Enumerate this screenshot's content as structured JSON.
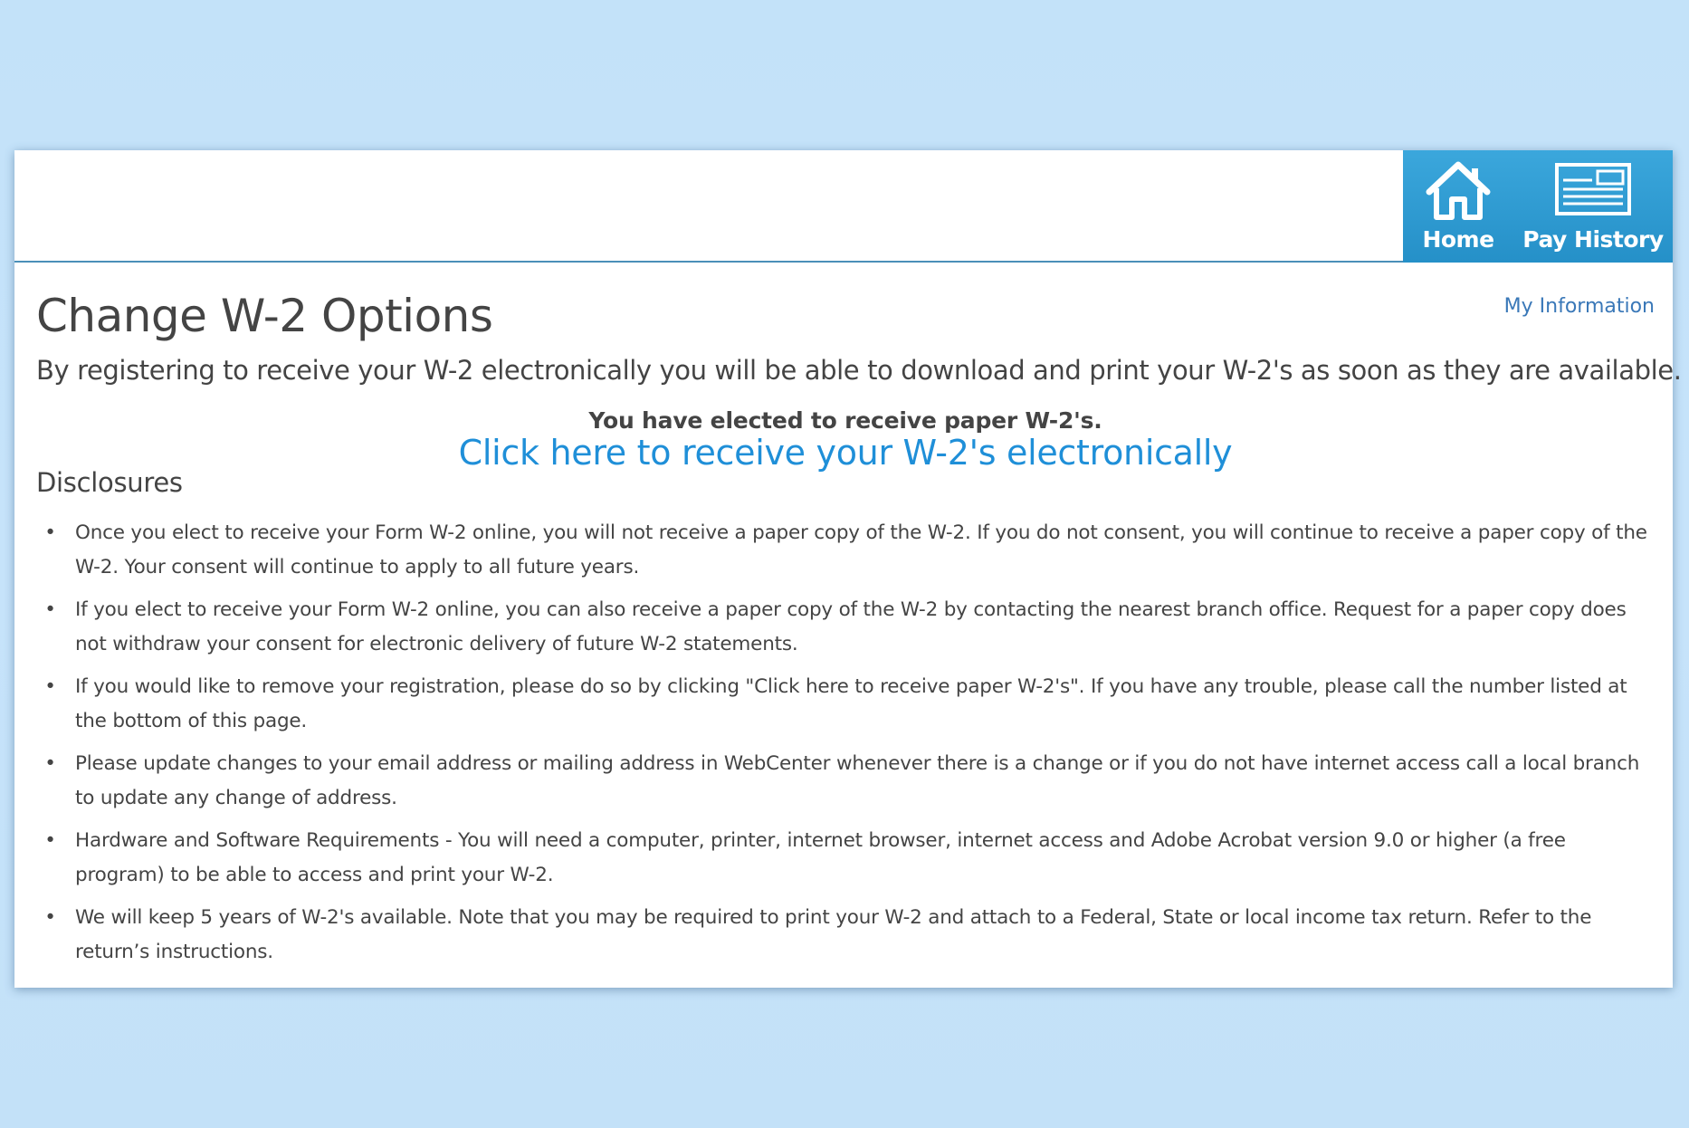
{
  "nav": {
    "home_label": "Home",
    "pay_history_label": "Pay History"
  },
  "page": {
    "title": "Change W-2 Options",
    "my_information_link": "My Information",
    "intro": "By registering to receive your W-2 electronically you will be able to download and print your W-2's as soon as they are available.",
    "elected_status": "You have elected to receive paper W-2's.",
    "electronic_link": "Click here to receive your W-2's electronically"
  },
  "disclosures": {
    "heading": "Disclosures",
    "items": [
      "Once you elect to receive your Form W-2 online, you will not receive a paper copy of the W-2. If you do not consent, you will continue to receive a paper copy of the W-2. Your consent will continue to apply to all future years.",
      "If you elect to receive your Form W-2 online, you can also receive a paper copy of the W-2 by contacting the nearest branch office. Request for a paper copy does not withdraw your consent for electronic delivery of future W-2 statements.",
      "If you would like to remove your registration, please do so by clicking \"Click here to receive paper W-2's\". If you have any trouble, please call the number listed at the bottom of this page.",
      "Please update changes to your email address or mailing address in WebCenter whenever there is a change or if you do not have internet access call a local branch to update any change of address.",
      "Hardware and Software Requirements - You will need a computer, printer, internet browser, internet access and Adobe Acrobat version 9.0 or higher (a free program) to be able to access and print your W-2.",
      "We will keep 5 years of W-2's available. Note that you may be required to print your W-2 and attach to a Federal, State or local income tax return. Refer to the return’s instructions."
    ]
  },
  "icons": {
    "home": "home-icon",
    "pay_history": "pay-stub-icon"
  },
  "colors": {
    "nav_background": "#2a99d0",
    "link": "#1f8fd8",
    "small_link": "#3a78b8",
    "text": "#444444",
    "page_background": "#c4e2f9"
  }
}
